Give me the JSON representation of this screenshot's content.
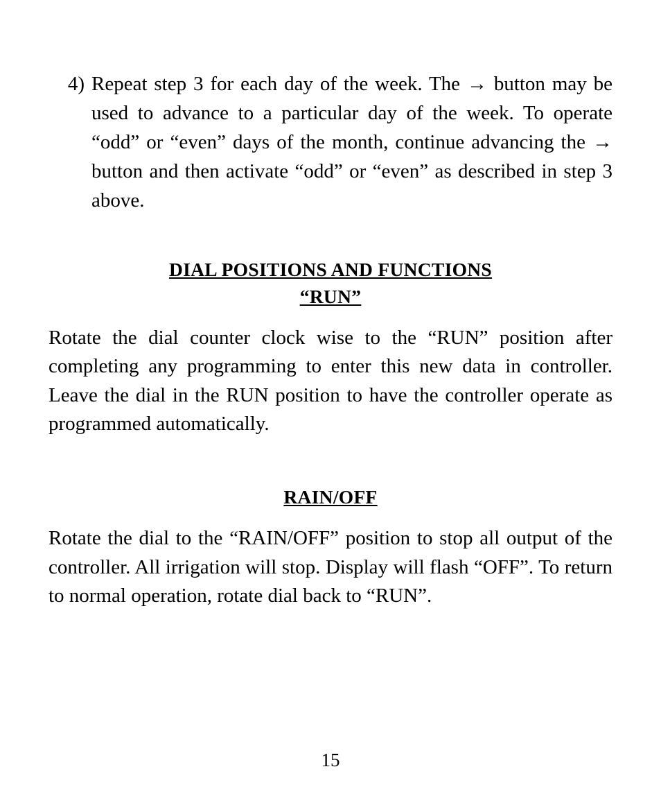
{
  "list": {
    "marker": "4)",
    "text_parts": [
      "Repeat step 3 for each day of the week. The ",
      " button may be used to advance to a particular day of the week. To operate “odd” or “even” days of the month, continue advancing the ",
      " button and then activate “odd” or “even” as described in step 3 above."
    ],
    "arrow": "→"
  },
  "section1": {
    "heading_line1": "DIAL POSITIONS AND FUNCTIONS",
    "heading_line2": "“RUN”",
    "body": "Rotate the dial counter clock wise to the “RUN” position after completing any programming to enter this new data in controller. Leave the dial in the RUN position to have the controller operate as programmed automatically."
  },
  "section2": {
    "heading": "RAIN/OFF",
    "body": "Rotate the dial to the “RAIN/OFF” position to stop all output of the controller. All irrigation will stop. Display will flash “OFF”. To return to normal operation, rotate dial back to “RUN”."
  },
  "page_number": "15"
}
